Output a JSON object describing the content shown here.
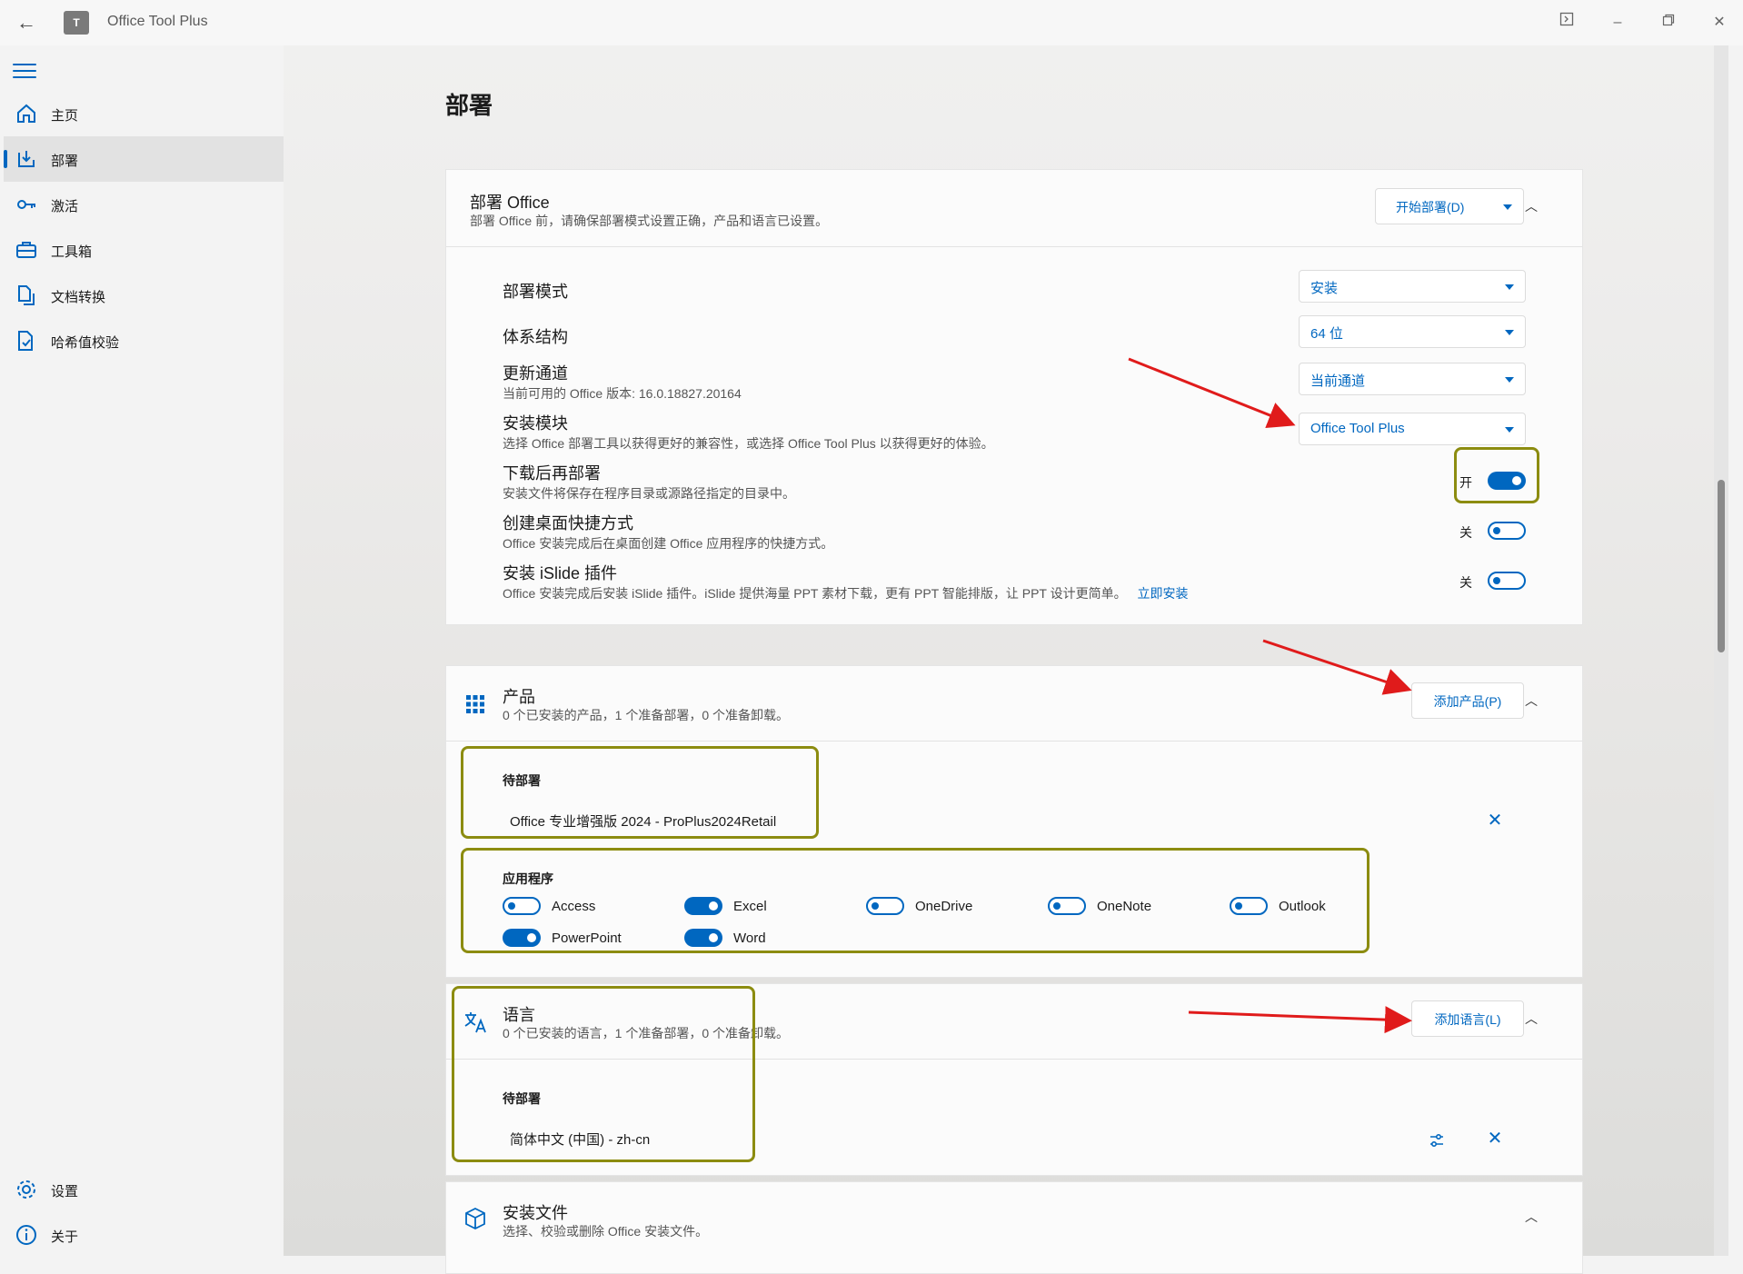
{
  "window": {
    "title": "Office Tool Plus",
    "logo_text": "T"
  },
  "sidebar": {
    "items": [
      {
        "label": "主页"
      },
      {
        "label": "部署"
      },
      {
        "label": "激活"
      },
      {
        "label": "工具箱"
      },
      {
        "label": "文档转换"
      },
      {
        "label": "哈希值校验"
      }
    ],
    "footer": [
      {
        "label": "设置"
      },
      {
        "label": "关于"
      }
    ]
  },
  "page": {
    "title": "部署"
  },
  "deploy": {
    "title": "部署 Office",
    "subtitle": "部署 Office 前，请确保部署模式设置正确，产品和语言已设置。",
    "start_button": "开始部署(D)",
    "rows": [
      {
        "title": "部署模式",
        "value": "安装"
      },
      {
        "title": "体系结构",
        "value": "64 位"
      },
      {
        "title": "更新通道",
        "subtitle": "当前可用的 Office 版本: 16.0.18827.20164",
        "value": "当前通道"
      },
      {
        "title": "安装模块",
        "subtitle": "选择 Office 部署工具以获得更好的兼容性，或选择 Office Tool Plus 以获得更好的体验。",
        "value": "Office Tool Plus"
      }
    ],
    "toggles": [
      {
        "title": "下载后再部署",
        "subtitle": "安装文件将保存在程序目录或源路径指定的目录中。",
        "state": "开"
      },
      {
        "title": "创建桌面快捷方式",
        "subtitle": "Office 安装完成后在桌面创建 Office 应用程序的快捷方式。",
        "state": "关"
      },
      {
        "title": "安装 iSlide 插件",
        "subtitle": "Office 安装完成后安装 iSlide 插件。iSlide 提供海量 PPT 素材下载，更有 PPT 智能排版，让 PPT 设计更简单。",
        "link": "立即安装",
        "state": "关"
      }
    ]
  },
  "products": {
    "title": "产品",
    "subtitle": "0 个已安装的产品，1 个准备部署，0 个准备卸载。",
    "add_button": "添加产品(P)",
    "pending_label": "待部署",
    "pending_item": "Office 专业增强版 2024  -  ProPlus2024Retail",
    "apps_label": "应用程序",
    "apps": [
      {
        "name": "Access",
        "on": false
      },
      {
        "name": "Excel",
        "on": true
      },
      {
        "name": "OneDrive",
        "on": false
      },
      {
        "name": "OneNote",
        "on": false
      },
      {
        "name": "Outlook",
        "on": false
      },
      {
        "name": "PowerPoint",
        "on": true
      },
      {
        "name": "Word",
        "on": true
      }
    ]
  },
  "languages": {
    "title": "语言",
    "subtitle": "0 个已安装的语言，1 个准备部署，0 个准备卸载。",
    "add_button": "添加语言(L)",
    "pending_label": "待部署",
    "pending_item": "简体中文 (中国)  -  zh-cn"
  },
  "install_files": {
    "title": "安装文件",
    "subtitle": "选择、校验或删除 Office 安装文件。"
  },
  "colors": {
    "accent": "#0067c0",
    "highlight": "#8c8c10",
    "annotation_arrow": "#e01b1b"
  }
}
